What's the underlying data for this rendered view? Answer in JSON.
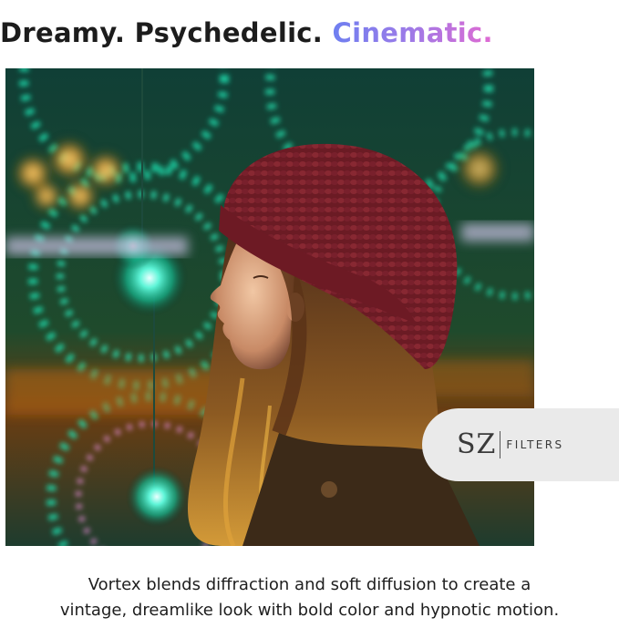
{
  "headline": {
    "part1": "Dreamy. Psychedelic. ",
    "part2": "Cinematic."
  },
  "photo": {
    "subject": "woman-in-knit-beanie-with-diffraction-lights"
  },
  "badge": {
    "logo": "SZ",
    "label": "FILTERS"
  },
  "caption": {
    "line1": "Vortex blends diffraction and soft diffusion to create a",
    "line2": "vintage, dreamlike look with bold color and hypnotic motion."
  },
  "colors": {
    "accent_start": "#6f7ff0",
    "accent_end": "#e06ad2",
    "text": "#1c1c1c",
    "badge_bg": "#eaeaea"
  }
}
